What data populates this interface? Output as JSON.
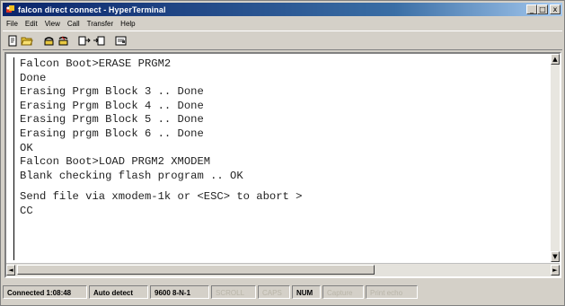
{
  "window": {
    "title": "falcon direct connect - HyperTerminal",
    "controls": {
      "minimize": "_",
      "maximize": "□",
      "close": "x"
    }
  },
  "menu": [
    "File",
    "Edit",
    "View",
    "Call",
    "Transfer",
    "Help"
  ],
  "toolbar": {
    "icons": [
      "new-connection-icon",
      "open-icon",
      "call-icon",
      "disconnect-icon",
      "send-icon",
      "receive-icon",
      "properties-icon"
    ]
  },
  "terminal": {
    "lines": [
      "Falcon Boot>ERASE PRGM2",
      "Done",
      "Erasing Prgm Block 3 .. Done",
      "Erasing Prgm Block 4 .. Done",
      "Erasing Prgm Block 5 .. Done",
      "Erasing prgm Block 6 .. Done",
      "OK",
      "Falcon Boot>LOAD PRGM2 XMODEM",
      "Blank checking flash program .. OK",
      "",
      "Send file via xmodem-1k or <ESC> to abort >",
      "CC"
    ]
  },
  "status": {
    "connected": "Connected 1:08:48",
    "detect": "Auto detect",
    "settings": "9600 8-N-1",
    "scroll": "SCROLL",
    "caps": "CAPS",
    "num": "NUM",
    "capture": "Capture",
    "print_echo": "Print echo"
  },
  "colors": {
    "titlebar_start": "#0a246a",
    "titlebar_end": "#a6caf0",
    "chrome": "#d4d0c8"
  }
}
